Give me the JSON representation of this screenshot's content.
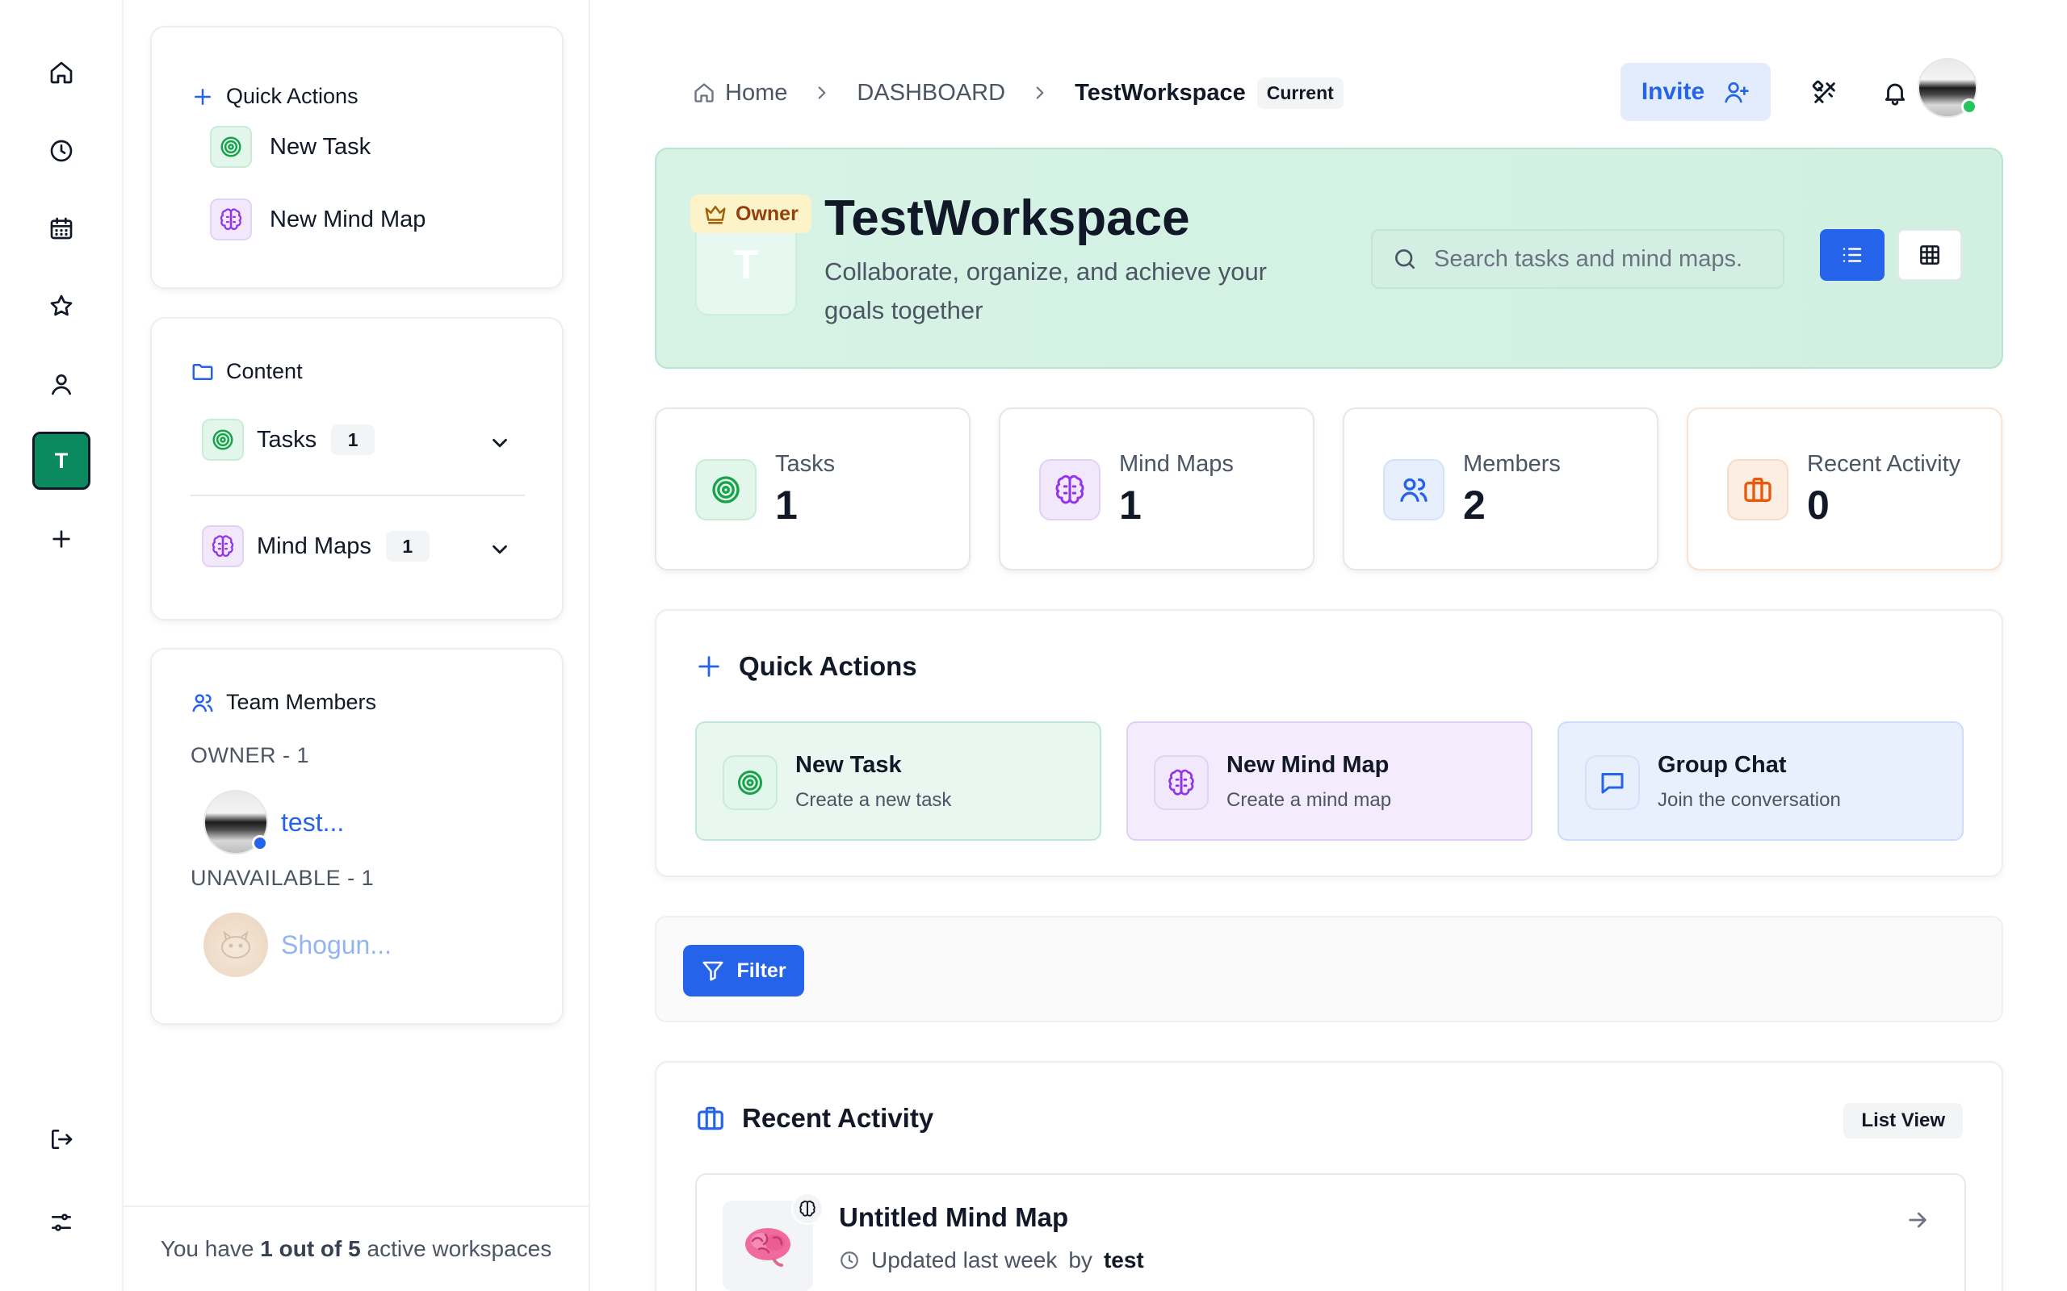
{
  "rail": {
    "workspace_initial": "T"
  },
  "sidebar": {
    "quick_actions": {
      "title": "Quick Actions",
      "items": [
        {
          "label": "New Task",
          "icon": "target-icon"
        },
        {
          "label": "New Mind Map",
          "icon": "brain-icon"
        }
      ]
    },
    "content": {
      "title": "Content",
      "items": [
        {
          "label": "Tasks",
          "count": "1",
          "icon": "target-icon"
        },
        {
          "label": "Mind Maps",
          "count": "1",
          "icon": "brain-icon"
        }
      ]
    },
    "team": {
      "title": "Team Members",
      "groups": [
        {
          "label": "OWNER - 1",
          "members": [
            {
              "name": "test...",
              "status_color": "#2563eb"
            }
          ]
        },
        {
          "label": "UNAVAILABLE - 1",
          "members": [
            {
              "name": "Shogun..."
            }
          ]
        }
      ]
    },
    "footer": {
      "prefix": "You have ",
      "count": "1 out of 5",
      "suffix": " active workspaces"
    }
  },
  "header": {
    "breadcrumbs": [
      "Home",
      "DASHBOARD",
      "TestWorkspace"
    ],
    "current_tag": "Current",
    "invite_label": "Invite"
  },
  "hero": {
    "tile_initial": "T",
    "owner_tag": "Owner",
    "title": "TestWorkspace",
    "subtitle": "Collaborate, organize, and achieve your goals together",
    "search_placeholder": "Search tasks and mind maps..."
  },
  "stats": [
    {
      "label": "Tasks",
      "value": "1",
      "icon": "target-icon"
    },
    {
      "label": "Mind Maps",
      "value": "1",
      "icon": "brain-icon"
    },
    {
      "label": "Members",
      "value": "2",
      "icon": "users-icon"
    },
    {
      "label": "Recent Activity",
      "value": "0",
      "icon": "briefcase-icon"
    }
  ],
  "quick_actions": {
    "title": "Quick Actions",
    "cards": [
      {
        "title": "New Task",
        "subtitle": "Create a new task",
        "icon": "target-icon"
      },
      {
        "title": "New Mind Map",
        "subtitle": "Create a mind map",
        "icon": "brain-icon"
      },
      {
        "title": "Group Chat",
        "subtitle": "Join the conversation",
        "icon": "chat-icon"
      }
    ]
  },
  "filter": {
    "label": "Filter"
  },
  "recent_activity": {
    "title": "Recent Activity",
    "view_label": "List View",
    "items": [
      {
        "name": "Untitled Mind Map",
        "updated": "Updated last week",
        "by_label": "by",
        "author": "test"
      }
    ]
  },
  "colors": {
    "accent": "#2563eb",
    "workspace": "#0b8a5f",
    "hero_bg": "#d6f3e6",
    "online": "#22c55e"
  }
}
